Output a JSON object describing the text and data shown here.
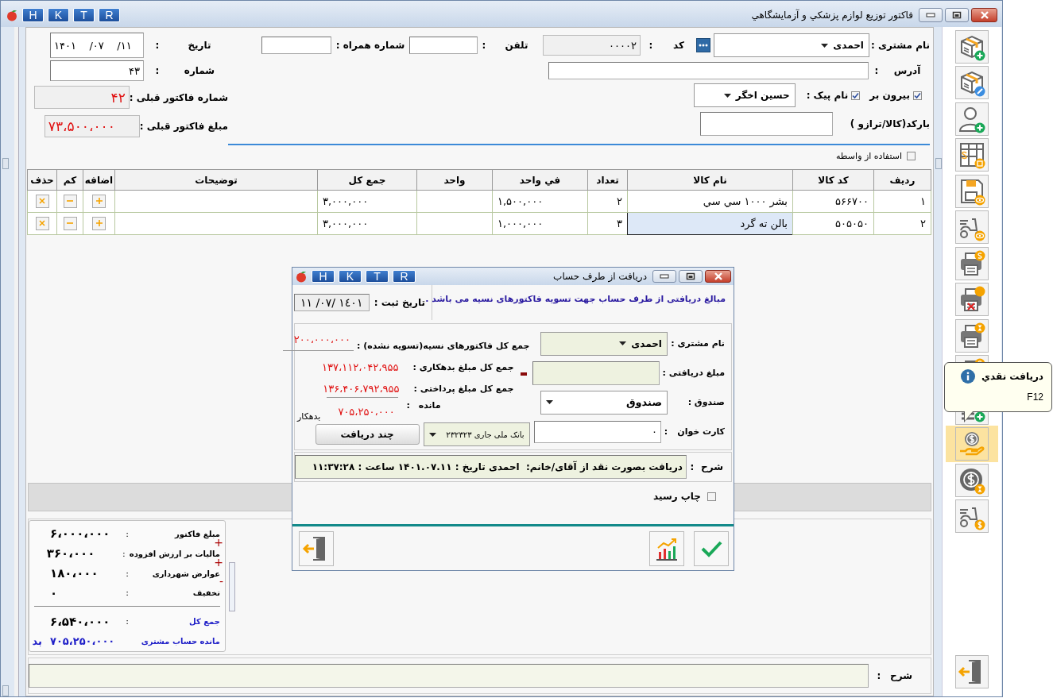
{
  "window": {
    "title": "فاکتور توزیع لوازم پزشکي و آزمايشگاهي",
    "title_buttons": [
      "R",
      "T",
      "K",
      "H"
    ]
  },
  "header": {
    "customer": {
      "label": "نام مشتری :",
      "value": "احمدی"
    },
    "code": {
      "label": "کد",
      "colon": ":",
      "value": "۰۰۰۰۲"
    },
    "phone": {
      "label": "تلفن",
      "colon": ":"
    },
    "mobile": {
      "label": "شماره همراه :"
    },
    "address": {
      "label": "آدرس",
      "colon": ":"
    },
    "outside": {
      "label": "بیرون بر",
      "checked": true
    },
    "courier": {
      "label": "نام پیک :",
      "checked": true,
      "value": "حسین اخگر"
    },
    "barcode": {
      "label": "بارکد(کالا/ترازو )"
    },
    "date": {
      "label": "تاریخ",
      "colon": ":",
      "value": "۱۴۰۱    /۰۷    /۱۱"
    },
    "number": {
      "label": "شماره",
      "colon": ":",
      "value": "۴۳"
    },
    "prev_number": {
      "label": "شماره فاکتور قبلی :",
      "value": "۴۲"
    },
    "prev_amount": {
      "label": "مبلغ فاکتور قبلی :",
      "value": "۷۳،۵۰۰،۰۰۰"
    }
  },
  "intermediary": {
    "label": "استفاده از واسطه",
    "checked": false
  },
  "table": {
    "columns": [
      "ردیف",
      "کد کالا",
      "نام کالا",
      "تعداد",
      "في واحد",
      "واحد",
      "جمع کل",
      "توضیحات",
      "اضافه",
      "کم",
      "حذف"
    ],
    "rows": [
      {
        "row": "۱",
        "code": "۵۶۶۷۰۰",
        "name": "بشر ۱۰۰۰ سي سي",
        "qty": "۲",
        "unit_price": "۱,۵۰۰,۰۰۰",
        "total": "۳,۰۰۰,۰۰۰",
        "selected": false
      },
      {
        "row": "۲",
        "code": "۵۰۵۰۵۰",
        "name": "بالن ته گرد",
        "qty": "۳",
        "unit_price": "۱,۰۰۰,۰۰۰",
        "total": "۳,۰۰۰,۰۰۰",
        "selected": true
      }
    ]
  },
  "summary": {
    "lines": [
      {
        "label": "مبلغ فاکتور",
        "colon": ":",
        "value": "۶،۰۰۰،۰۰۰"
      },
      {
        "label": "مالیات بر ارزش افزوده",
        "colon": ":",
        "value": "۳۶۰،۰۰۰",
        "sign": "+"
      },
      {
        "label": "عوارض شهرداری",
        "colon": ":",
        "value": "۱۸۰،۰۰۰",
        "sign": "+"
      },
      {
        "label": "تخفیف",
        "colon": ":",
        "value": "۰",
        "sign": "-"
      }
    ],
    "total": {
      "label": "جمع کل",
      "colon": ":",
      "value": "۶،۵۴۰،۰۰۰"
    },
    "balance": {
      "label": "مانده حساب مشتری",
      "value": "۷۰۵،۲۵۰،۰۰۰",
      "status": "بد"
    }
  },
  "footer": {
    "label": "شرح",
    "colon": ":"
  },
  "toolbar": [
    {
      "kind": "boxadd",
      "selected": false
    },
    {
      "kind": "boxedit",
      "selected": false
    },
    {
      "kind": "useradd",
      "selected": false
    },
    {
      "kind": "sheet",
      "selected": false
    },
    {
      "kind": "disk",
      "selected": false
    },
    {
      "kind": "scootereye",
      "selected": false
    },
    {
      "kind": "printmoney",
      "selected": false
    },
    {
      "kind": "printcancel",
      "selected": false
    },
    {
      "kind": "printwait",
      "selected": false
    },
    {
      "kind": "printmoney",
      "selected": false
    },
    {
      "kind": "listok",
      "selected": false
    },
    {
      "kind": "cashhand",
      "selected": true
    },
    {
      "kind": "coinwait",
      "selected": false
    },
    {
      "kind": "scootermoney",
      "selected": false
    },
    {
      "kind": "exit",
      "selected": false
    }
  ],
  "tooltip": {
    "title": "دریافت نقدي",
    "shortcut": "F12"
  },
  "dialog": {
    "title": "دریافت از طرف حساب",
    "title_buttons": [
      "R",
      "T",
      "K",
      "H"
    ],
    "info": "مبالغ دریافتی از طرف حساب جهت تسویه فاکتورهای نسیه می باشد .",
    "date": {
      "label": "تاریخ ثبت :",
      "value": "١٤٠١ /٠٧/ ١١"
    },
    "customer": {
      "label": "نام مشتری :",
      "value": "احمدی"
    },
    "amount": {
      "label": "مبلغ دریافتی :"
    },
    "fund": {
      "label": "صندوق :",
      "value": "صندوق"
    },
    "card": {
      "label": "کارت خوان",
      "colon": ":",
      "value": "۰"
    },
    "bank": {
      "value": "بانک ملی جاری ۲۳۲۳۲۳"
    },
    "multi_button": "چند دریافت",
    "unsettled": {
      "label": "جمع کل فاکتورهای نسیه(تسویه نشده) :",
      "value": "۲۰۰،۰۰۰،۰۰۰"
    },
    "debit": {
      "label": "جمع کل مبلغ بدهکاری :",
      "value": "۱۳۷،۱۱۲،۰۴۲،۹۵۵"
    },
    "paid": {
      "label": "جمع کل مبلغ پرداختی :",
      "value": "۱۳۶،۴۰۶،۷۹۲،۹۵۵"
    },
    "remaining": {
      "label": "مانده",
      "colon": ":",
      "value": "۷۰۵،۲۵۰،۰۰۰",
      "status": "بدهکار"
    },
    "description": {
      "label": "شرح",
      "colon": ":",
      "value": "دریافت بصورت نقد از آقای/خانم:  احمدی تاریخ : ۱۴۰۱.۰۷.۱۱ ساعت : ۱۱:۳۷:۲۸"
    },
    "print_receipt": {
      "label": "چاپ رسید",
      "checked": false
    }
  }
}
